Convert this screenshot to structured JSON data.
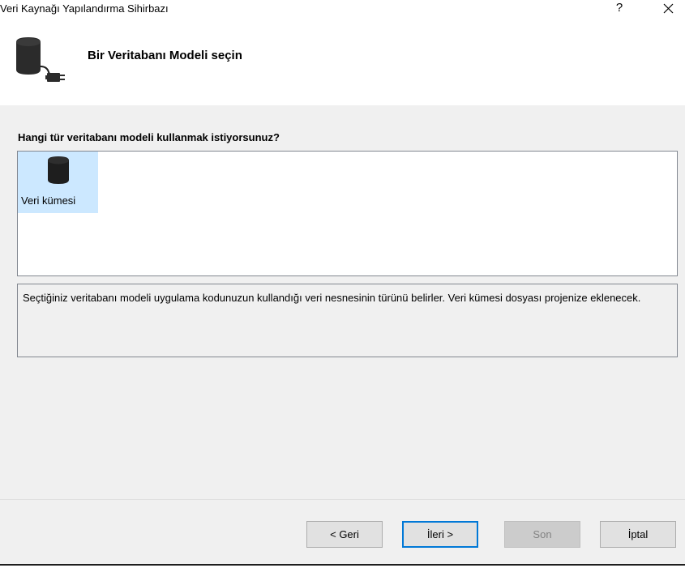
{
  "window": {
    "title": "Veri Kaynağı Yapılandırma Sihirbazı",
    "help_label": "?"
  },
  "header": {
    "title": "Bir Veritabanı Modeli seçin",
    "icon": "database-plug-icon"
  },
  "main": {
    "question": "Hangi tür veritabanı modeli kullanmak istiyorsunuz?",
    "models": [
      {
        "label": "Veri kümesi",
        "icon": "database-icon",
        "selected": true
      }
    ],
    "description": "Seçtiğiniz veritabanı modeli uygulama kodunuzun kullandığı veri nesnesinin türünü belirler. Veri kümesi dosyası projenize eklenecek."
  },
  "footer": {
    "back_label": "< Geri",
    "next_label": "İleri >",
    "finish_label": "Son",
    "cancel_label": "İptal"
  },
  "colors": {
    "selection": "#cce8ff",
    "panel_bg": "#f0f0f0",
    "default_button_border": "#0078d7",
    "list_border": "#828790"
  }
}
